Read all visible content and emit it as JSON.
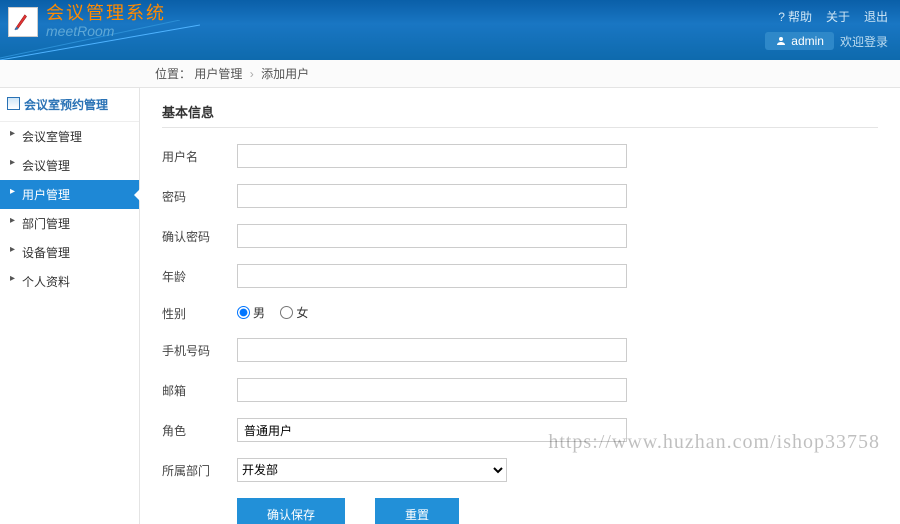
{
  "header": {
    "title": "会议管理系统",
    "subtitle": "meetRoom",
    "links": {
      "help": "帮助",
      "about": "关于",
      "logout": "退出"
    },
    "user": "admin",
    "welcome": "欢迎登录"
  },
  "breadcrumb": {
    "label": "位置：",
    "parent": "用户管理",
    "current": "添加用户"
  },
  "sidebar": {
    "heading": "会议室预约管理",
    "items": [
      {
        "label": "会议室管理",
        "active": false
      },
      {
        "label": "会议管理",
        "active": false
      },
      {
        "label": "用户管理",
        "active": true
      },
      {
        "label": "部门管理",
        "active": false
      },
      {
        "label": "设备管理",
        "active": false
      },
      {
        "label": "个人资料",
        "active": false
      }
    ]
  },
  "form": {
    "section_title": "基本信息",
    "fields": {
      "username": {
        "label": "用户名",
        "value": ""
      },
      "password": {
        "label": "密码",
        "value": ""
      },
      "confirm": {
        "label": "确认密码",
        "value": ""
      },
      "age": {
        "label": "年龄",
        "value": ""
      },
      "gender": {
        "label": "性别",
        "options": [
          "男",
          "女"
        ],
        "selected": "男"
      },
      "phone": {
        "label": "手机号码",
        "value": ""
      },
      "email": {
        "label": "邮箱",
        "value": ""
      },
      "role": {
        "label": "角色",
        "value": "普通用户"
      },
      "dept": {
        "label": "所属部门",
        "options": [
          "开发部"
        ],
        "selected": "开发部"
      }
    },
    "buttons": {
      "save": "确认保存",
      "reset": "重置"
    }
  },
  "watermark": "https://www.huzhan.com/ishop33758"
}
